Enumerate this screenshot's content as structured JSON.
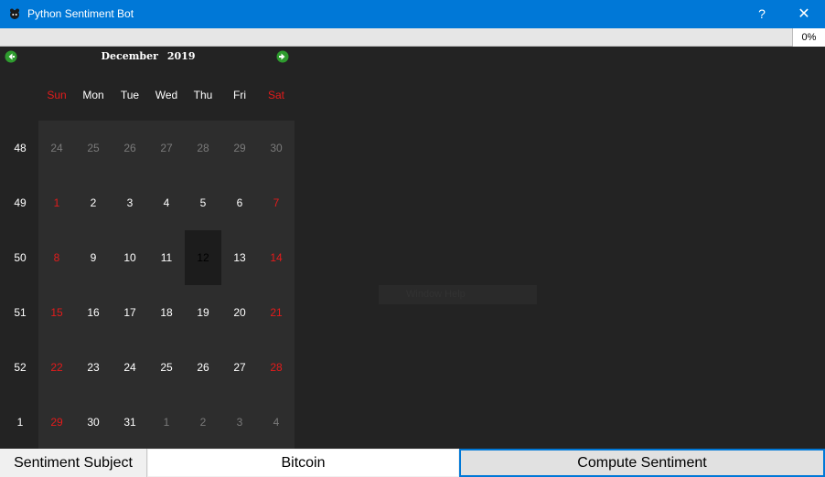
{
  "window": {
    "title": "Python Sentiment Bot",
    "help": "?",
    "close": "✕",
    "accent": "#0078d7"
  },
  "progress": {
    "label": "0%",
    "value": 0
  },
  "calendar": {
    "month": "December",
    "year": "2019",
    "prev_icon": "left-arrow-icon",
    "next_icon": "right-arrow-icon",
    "weekdays": [
      "Sun",
      "Mon",
      "Tue",
      "Wed",
      "Thu",
      "Fri",
      "Sat"
    ],
    "week_numbers": [
      "48",
      "49",
      "50",
      "51",
      "52",
      "1"
    ],
    "weeks": [
      [
        "24",
        "25",
        "26",
        "27",
        "28",
        "29",
        "30"
      ],
      [
        "1",
        "2",
        "3",
        "4",
        "5",
        "6",
        "7"
      ],
      [
        "8",
        "9",
        "10",
        "11",
        "12",
        "13",
        "14"
      ],
      [
        "15",
        "16",
        "17",
        "18",
        "19",
        "20",
        "21"
      ],
      [
        "22",
        "23",
        "24",
        "25",
        "26",
        "27",
        "28"
      ],
      [
        "29",
        "30",
        "31",
        "1",
        "2",
        "3",
        "4"
      ]
    ],
    "selected_day": "12",
    "weekend_color": "#e41b1b"
  },
  "watermark_text": "Window Help",
  "bottom": {
    "subject_label": "Sentiment Subject",
    "subject_value": "Bitcoin",
    "compute_label": "Compute Sentiment"
  }
}
